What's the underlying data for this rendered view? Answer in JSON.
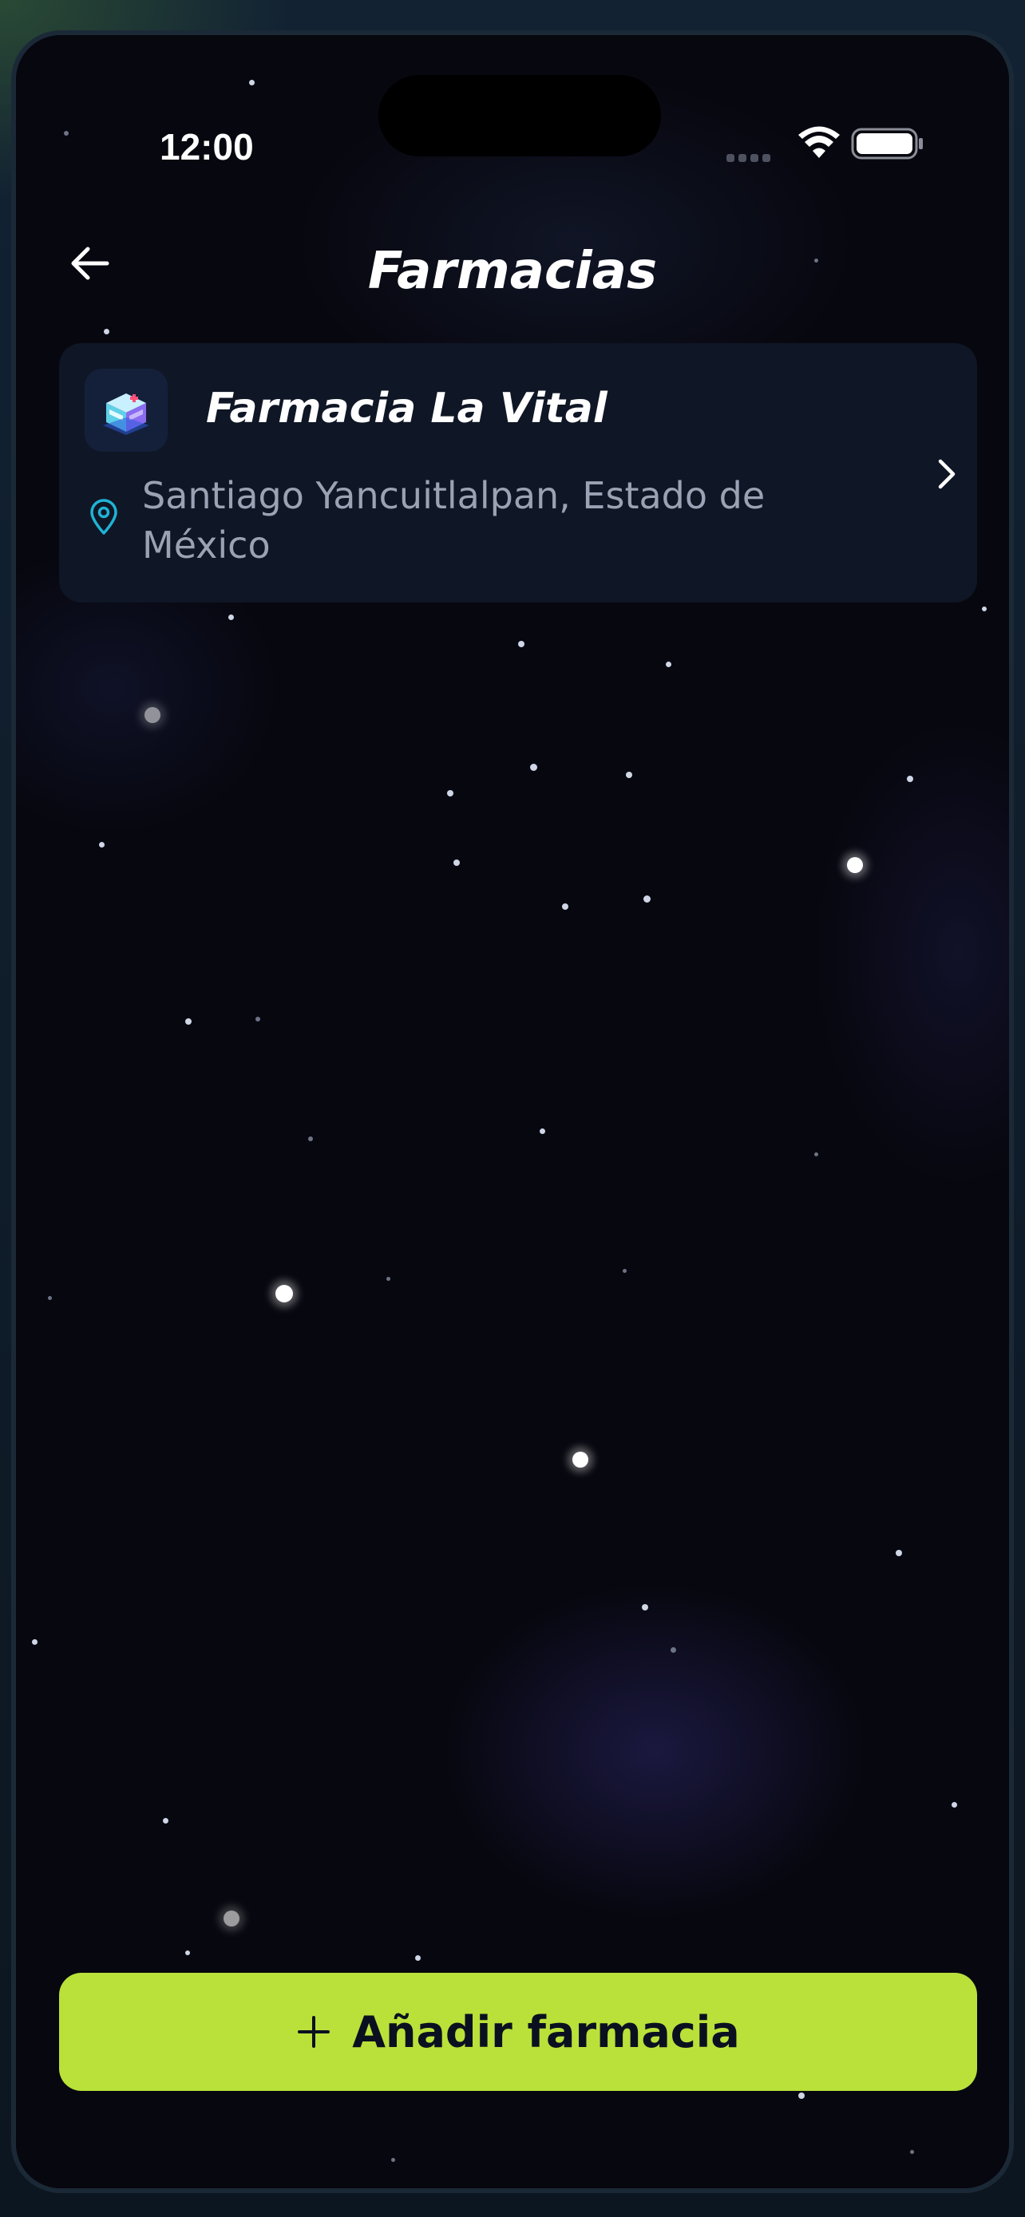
{
  "status_bar": {
    "time": "12:00"
  },
  "header": {
    "title": "Farmacias"
  },
  "pharmacies": [
    {
      "name": "Farmacia La Vital",
      "address": "Santiago Yancuitlalpan, Estado de México",
      "icon": "pharmacy-building-icon"
    }
  ],
  "actions": {
    "add_label": "Añadir farmacia"
  },
  "colors": {
    "background": "#07070f",
    "card": "#0f1625",
    "accent": "#b9e13a",
    "pin": "#1fb3d6"
  }
}
